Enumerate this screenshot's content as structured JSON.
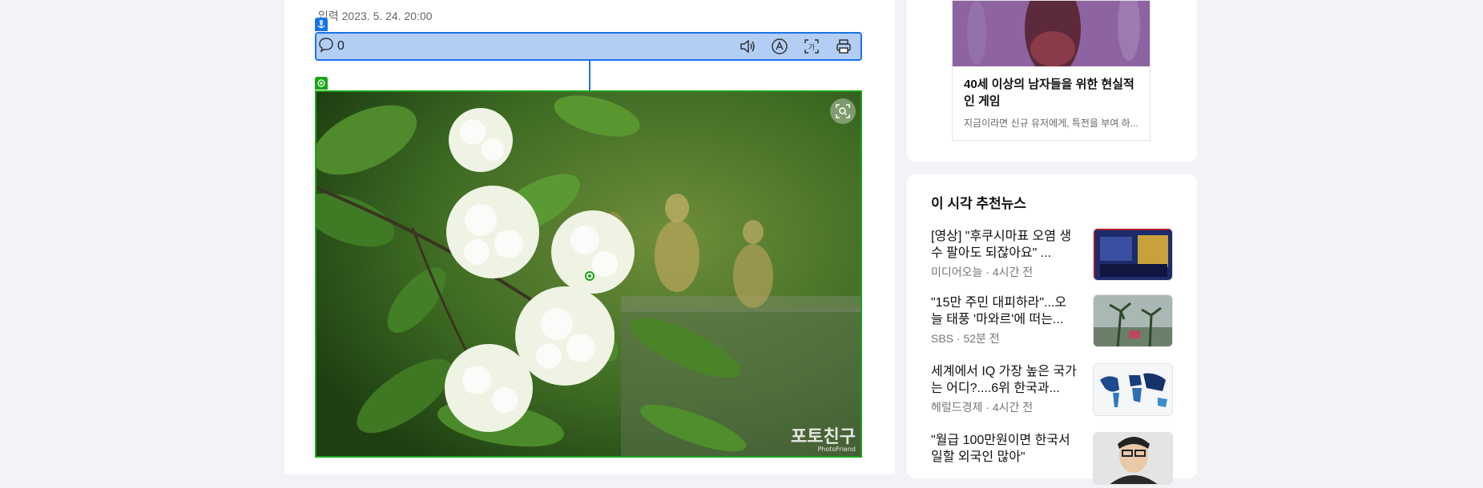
{
  "article": {
    "date_line": "입력 2023. 5. 24. 20:00",
    "comment_count": "0",
    "toolbar_icons": [
      "speaker-icon",
      "font-size-icon",
      "translate-icon",
      "print-icon"
    ],
    "photo_watermark": "포토친구",
    "photo_watermark_sub": "PhotoFriend",
    "selection_color": "#1a73e8",
    "target_color": "#1aa31a"
  },
  "ad": {
    "title": "40세 이상의 남자들을 위한 현실적인 게임",
    "description": "지금이라면 신규 유저에게, 특전을 부여 하..."
  },
  "recommended": {
    "heading": "이 시각 추천뉴스",
    "items": [
      {
        "title": "[영상] \"후쿠시마표 오염 생수 팔아도 되잖아요\" ...",
        "meta": "미디어오늘 · 4시간 전"
      },
      {
        "title": "\"15만 주민 대피하라\"...오늘 태풍 '마와르'에 떠는...",
        "meta": "SBS · 52분 전"
      },
      {
        "title": "세계에서 IQ 가장 높은 국가는 어디?....6위 한국과...",
        "meta": "헤럴드경제 · 4시간 전"
      },
      {
        "title": "\"월급 100만원이면 한국서 일할 외국인 많아\"",
        "meta": ""
      }
    ]
  }
}
